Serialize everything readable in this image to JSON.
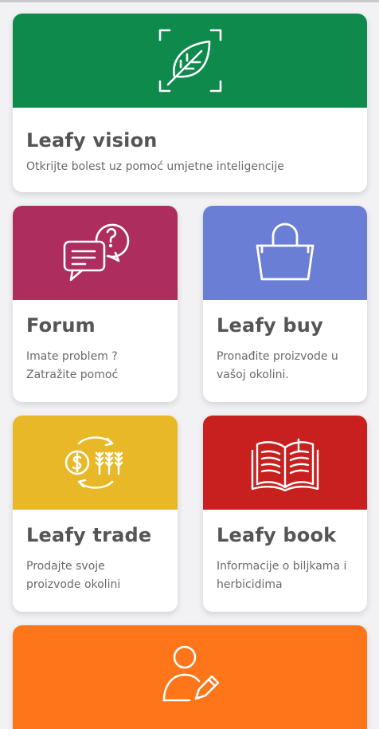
{
  "cards": [
    {
      "title": "Leafy vision",
      "desc_lines": [
        "Otkrijte bolest uz pomoć umjetne inteligencije"
      ],
      "color": "#0d8a4c",
      "icon": "leaf-scan-icon"
    },
    {
      "title": "Forum",
      "desc_lines": [
        "Imate problem ?",
        "Zatražite pomoć"
      ],
      "color": "#ad2d5e",
      "icon": "chat-question-icon"
    },
    {
      "title": "Leafy buy",
      "desc_lines": [
        "Pronađite proizvode u",
        "vašoj okolini."
      ],
      "color": "#6b7ed6",
      "icon": "shopping-bag-icon"
    },
    {
      "title": "Leafy trade",
      "desc_lines": [
        "Prodajte svoje",
        "proizvode okolini"
      ],
      "color": "#e9b828",
      "icon": "trade-exchange-icon"
    },
    {
      "title": "Leafy book",
      "desc_lines": [
        "Informacije o biljkama i",
        "herbicidima"
      ],
      "color": "#c8201f",
      "icon": "open-book-icon"
    },
    {
      "title": "",
      "desc_lines": [],
      "color": "#ff7519",
      "icon": "user-edit-icon"
    }
  ]
}
